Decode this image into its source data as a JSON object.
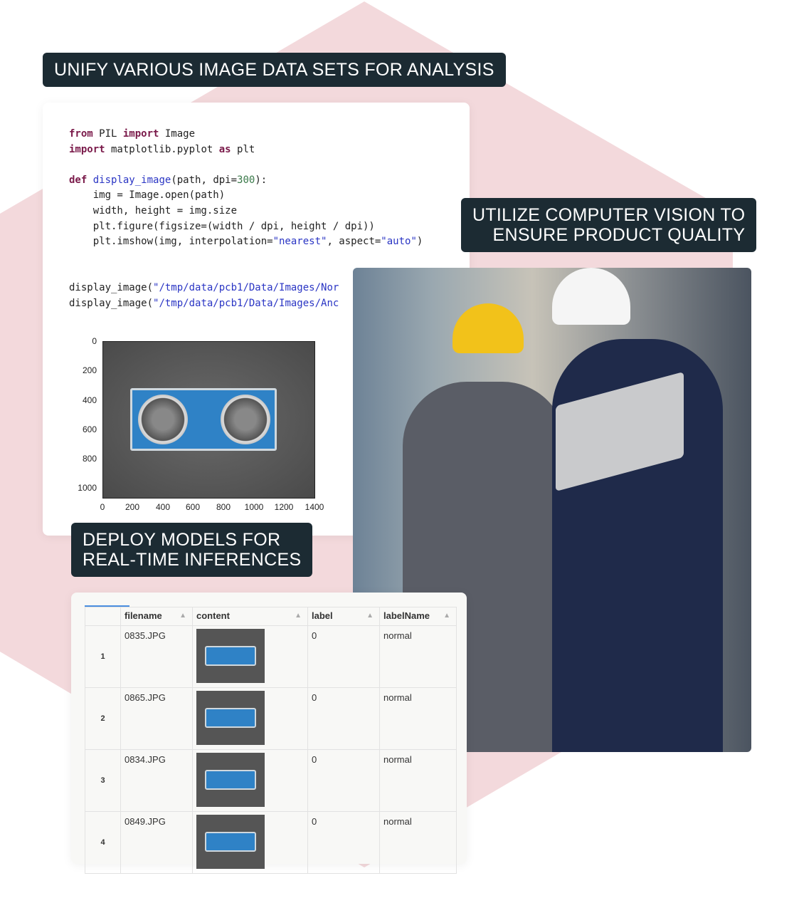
{
  "tags": {
    "unify": "UNIFY VARIOUS IMAGE DATA SETS FOR ANALYSIS",
    "utilize_1": "UTILIZE COMPUTER VISION TO",
    "utilize_2": "ENSURE PRODUCT QUALITY",
    "deploy_1": "DEPLOY MODELS FOR",
    "deploy_2": "REAL-TIME INFERENCES"
  },
  "code": {
    "l1": [
      "from",
      " PIL ",
      "import",
      " Image"
    ],
    "l2": [
      "import",
      " matplotlib.pyplot ",
      "as",
      " plt"
    ],
    "l3": [
      "def",
      " ",
      "display_image",
      "(path, dpi=",
      "300",
      "):"
    ],
    "l4": "    img = Image.open(path)",
    "l5": "    width, height = img.size",
    "l6": "    plt.figure(figsize=(width / dpi, height / dpi))",
    "l7": [
      "    plt.imshow(img, interpolation=",
      "\"nearest\"",
      ", aspect=",
      "\"auto\"",
      ")"
    ],
    "l8": [
      "display_image(",
      "\"/tmp/data/pcb1/Data/Images/Nor"
    ],
    "l9": [
      "display_image(",
      "\"/tmp/data/pcb1/Data/Images/Anc"
    ]
  },
  "plot": {
    "yticks": [
      "0",
      "200",
      "400",
      "600",
      "800",
      "1000"
    ],
    "xticks": [
      "0",
      "200",
      "400",
      "600",
      "800",
      "1000",
      "1200",
      "1400"
    ]
  },
  "table": {
    "headers": [
      "filename",
      "content",
      "label",
      "labelName"
    ],
    "rows": [
      {
        "index": "1",
        "filename": "0835.JPG",
        "label": "0",
        "labelName": "normal"
      },
      {
        "index": "2",
        "filename": "0865.JPG",
        "label": "0",
        "labelName": "normal"
      },
      {
        "index": "3",
        "filename": "0834.JPG",
        "label": "0",
        "labelName": "normal"
      },
      {
        "index": "4",
        "filename": "0849.JPG",
        "label": "0",
        "labelName": "normal"
      }
    ]
  }
}
